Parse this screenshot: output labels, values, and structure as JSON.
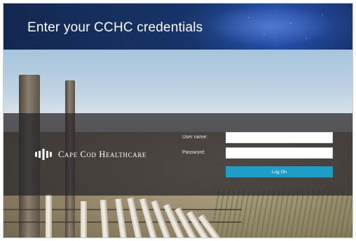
{
  "header": {
    "title": "Enter your CCHC credentials"
  },
  "login": {
    "brand_name": "Cape Cod Healthcare",
    "username_label": "User name:",
    "username_value": "",
    "password_label": "Password:",
    "password_value": "",
    "logon_label": "Log On"
  },
  "colors": {
    "header_background": "#17346a",
    "button_accent": "#1e9ec6",
    "panel_overlay": "#262228"
  }
}
